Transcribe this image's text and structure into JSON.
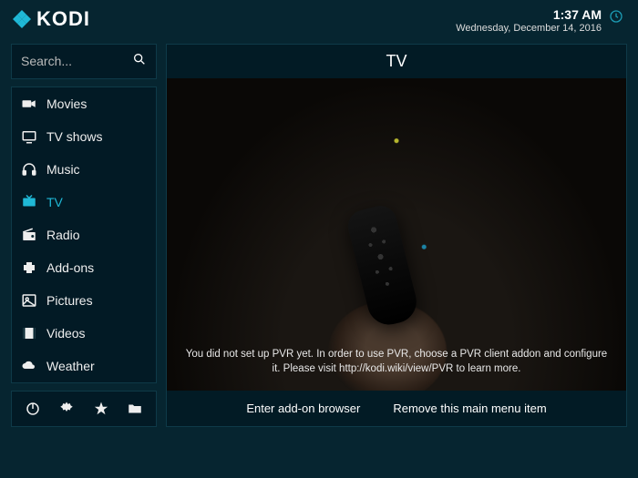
{
  "header": {
    "logo_text": "KODI",
    "time": "1:37 AM",
    "date": "Wednesday, December 14, 2016"
  },
  "search": {
    "placeholder": "Search..."
  },
  "sidebar": {
    "items": [
      {
        "label": "Movies",
        "icon": "camera"
      },
      {
        "label": "TV shows",
        "icon": "tv-outline"
      },
      {
        "label": "Music",
        "icon": "headphones"
      },
      {
        "label": "TV",
        "icon": "tv",
        "active": true
      },
      {
        "label": "Radio",
        "icon": "radio"
      },
      {
        "label": "Add-ons",
        "icon": "puzzle"
      },
      {
        "label": "Pictures",
        "icon": "image"
      },
      {
        "label": "Videos",
        "icon": "film"
      },
      {
        "label": "Weather",
        "icon": "cloud"
      }
    ]
  },
  "bottombar": {
    "buttons": [
      "power",
      "settings",
      "favorites",
      "file-manager"
    ]
  },
  "content": {
    "title": "TV",
    "message": "You did not set up PVR yet. In order to use PVR, choose a PVR client addon and configure it. Please visit http://kodi.wiki/view/PVR to learn more.",
    "actions": {
      "enter_browser": "Enter add-on browser",
      "remove_item": "Remove this main menu item"
    }
  }
}
